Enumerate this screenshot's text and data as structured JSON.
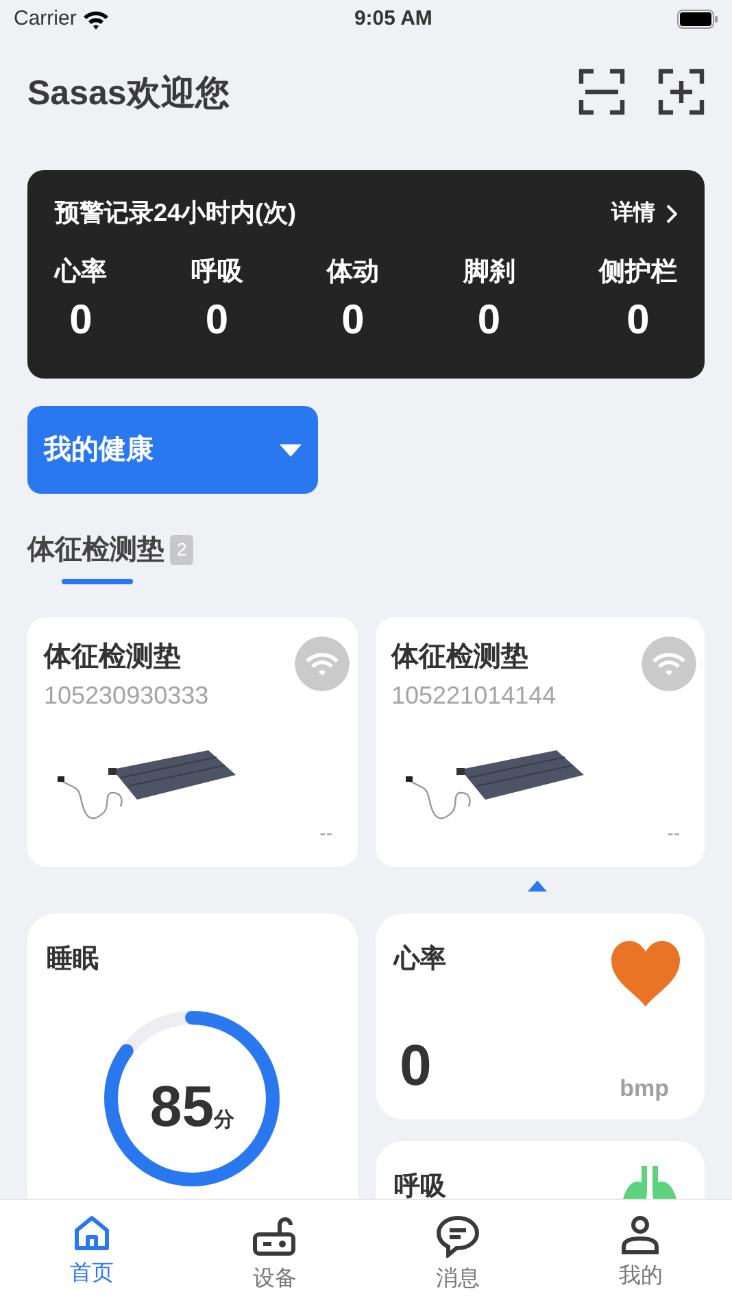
{
  "status_bar": {
    "carrier": "Carrier",
    "time": "9:05 AM"
  },
  "header": {
    "title": "Sasas欢迎您"
  },
  "alerts": {
    "title": "预警记录24小时内(次)",
    "details_link": "详情",
    "items": [
      {
        "label": "心率",
        "value": "0"
      },
      {
        "label": "呼吸",
        "value": "0"
      },
      {
        "label": "体动",
        "value": "0"
      },
      {
        "label": "脚刹",
        "value": "0"
      },
      {
        "label": "侧护栏",
        "value": "0"
      }
    ]
  },
  "dropdown": {
    "label": "我的健康"
  },
  "section": {
    "title": "体征检测垫",
    "count": "2"
  },
  "devices": [
    {
      "name": "体征检测垫",
      "serial": "105230930333",
      "online": false,
      "reading": "--"
    },
    {
      "name": "体征检测垫",
      "serial": "105221014144",
      "online": false,
      "reading": "--"
    }
  ],
  "sleep": {
    "title": "睡眠",
    "score": "85",
    "unit": "分",
    "level": 0.85
  },
  "heart_rate": {
    "title": "心率",
    "value": "0",
    "unit": "bmp"
  },
  "breathing": {
    "title": "呼吸"
  },
  "tab_bar": [
    {
      "label": "首页",
      "kind": "home",
      "selected": true
    },
    {
      "label": "设备",
      "kind": "device",
      "selected": false
    },
    {
      "label": "消息",
      "kind": "message",
      "selected": false
    },
    {
      "label": "我的",
      "kind": "profile",
      "selected": false
    }
  ]
}
